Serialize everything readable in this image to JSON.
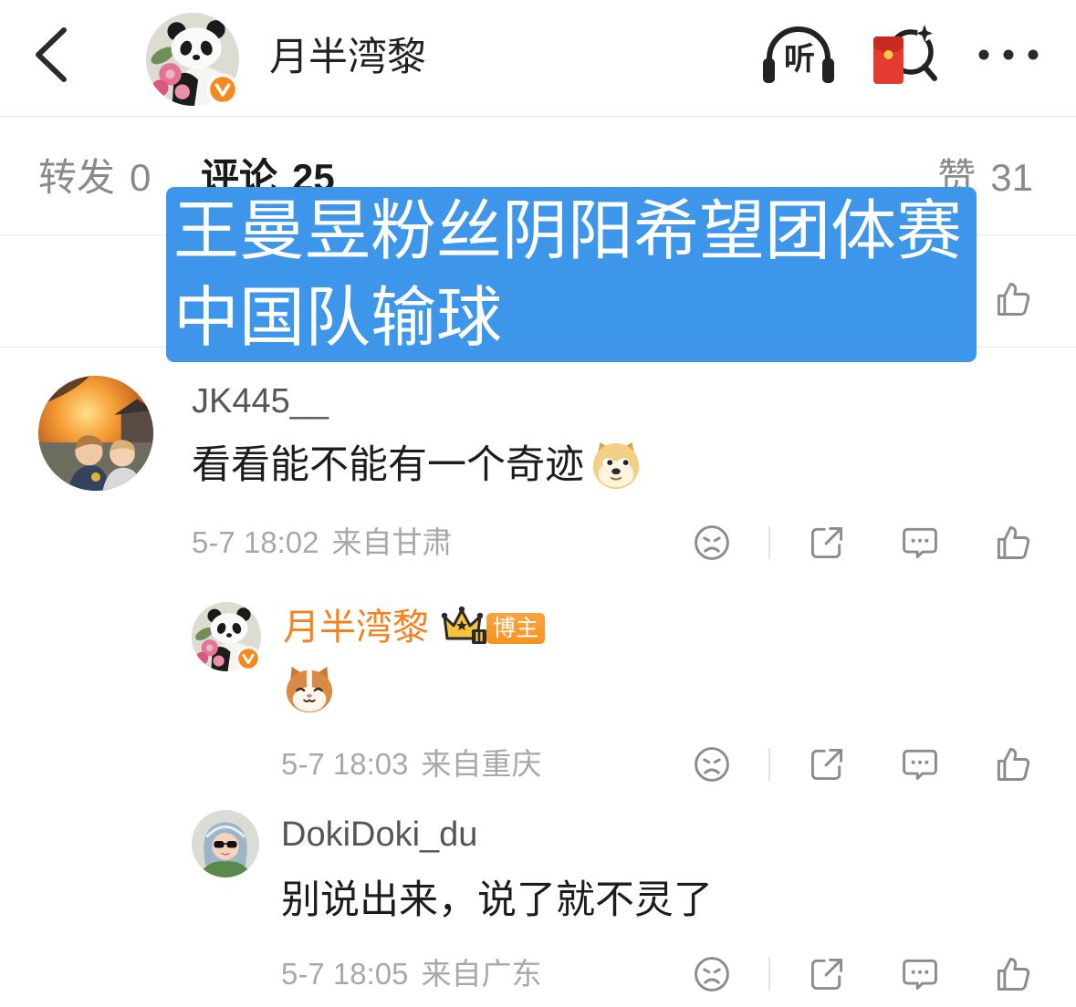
{
  "header": {
    "name": "月半湾黎",
    "listen_label": "听",
    "icons": {
      "back": "back-arrow-icon",
      "listen": "headphones-icon",
      "red_packet": "red-envelope-search-icon",
      "more": "more-dots-icon",
      "verified": "verified-badge-icon"
    }
  },
  "tabs": [
    {
      "label": "转发",
      "count": "0",
      "active": false
    },
    {
      "label": "评论",
      "count": "25",
      "active": true
    },
    {
      "label": "赞",
      "count": "31",
      "active": false
    }
  ],
  "overlay": {
    "lines": [
      "王曼昱粉丝阴阳希望团体赛",
      "中国队输球"
    ]
  },
  "comments": [
    {
      "user": "JK445__",
      "text": "看看能不能有一个奇迹",
      "emoji": "doge-emoji",
      "time": "5-7 18:02",
      "location": "来自甘肃"
    },
    {
      "user": "月半湾黎",
      "badge_icon": "crown-level-icon",
      "badge": "博主",
      "emoji": "cat-emoji",
      "time": "5-7 18:03",
      "location": "来自重庆"
    },
    {
      "user": "DokiDoki_du",
      "text": "别说出来，说了就不灵了",
      "time": "5-7 18:05",
      "location": "来自广东"
    }
  ],
  "actions": [
    "dislike-icon",
    "share-icon",
    "comment-icon",
    "like-icon"
  ],
  "colors": {
    "overlay_bg": "#3d96ea",
    "author_orange": "#f5821f",
    "username_gray": "#555555",
    "meta_gray": "#a8a8a8",
    "icon_gray": "#8c8c8c",
    "tag_orange": "#f7931e"
  }
}
